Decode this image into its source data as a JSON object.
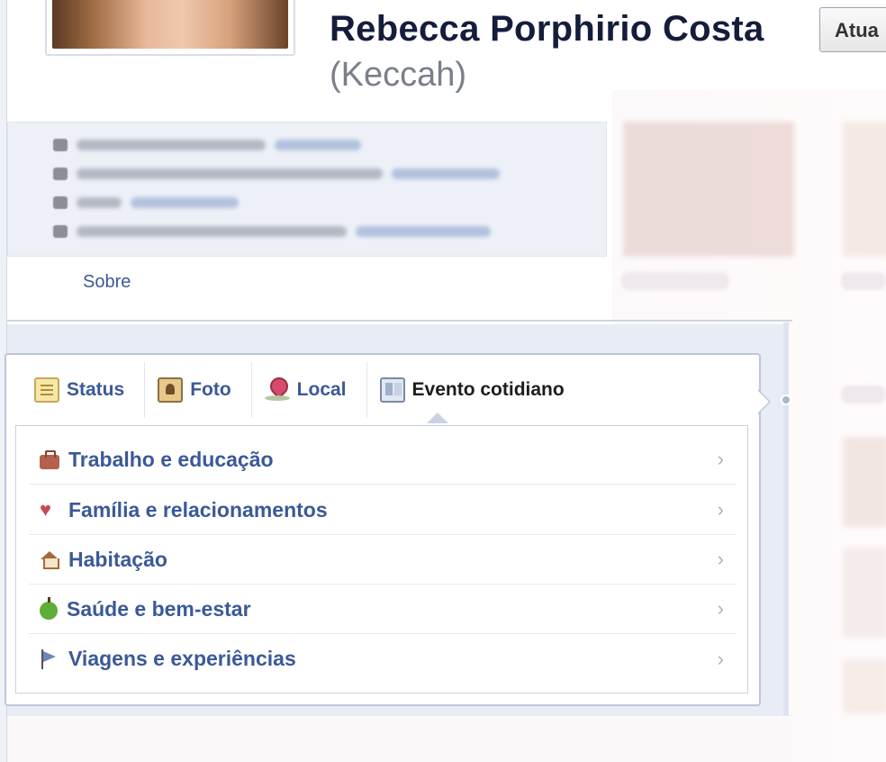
{
  "header": {
    "name": "Rebecca Porphirio Costa",
    "nickname": "(Keccah)",
    "update_button": "Atua"
  },
  "about": {
    "link_label": "Sobre"
  },
  "composer": {
    "tabs": [
      {
        "label": "Status",
        "icon": "status-note-icon"
      },
      {
        "label": "Foto",
        "icon": "photo-icon"
      },
      {
        "label": "Local",
        "icon": "location-pin-icon"
      },
      {
        "label": "Evento cotidiano",
        "icon": "life-event-icon"
      }
    ],
    "menu": [
      {
        "label": "Trabalho e educação",
        "icon": "briefcase-icon"
      },
      {
        "label": "Família e relacionamentos",
        "icon": "heart-icon"
      },
      {
        "label": "Habitação",
        "icon": "house-icon"
      },
      {
        "label": "Saúde e bem-estar",
        "icon": "apple-icon"
      },
      {
        "label": "Viagens e experiências",
        "icon": "flag-icon"
      }
    ]
  },
  "colors": {
    "link": "#3b5998",
    "name": "#141d3b",
    "nickname": "#7a7f8a"
  }
}
